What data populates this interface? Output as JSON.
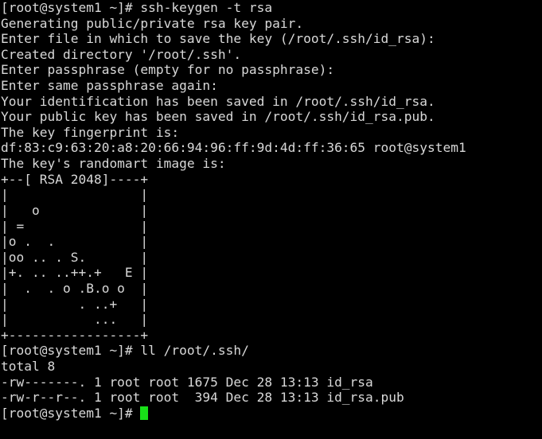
{
  "terminal": {
    "background_color": "#000000",
    "text_color": "#d8d8d8",
    "cursor_color": "#18e018",
    "prompt": "[root@system1 ~]#",
    "lines": [
      "[root@system1 ~]# ssh-keygen -t rsa",
      "Generating public/private rsa key pair.",
      "Enter file in which to save the key (/root/.ssh/id_rsa): ",
      "Created directory '/root/.ssh'.",
      "Enter passphrase (empty for no passphrase): ",
      "Enter same passphrase again: ",
      "Your identification has been saved in /root/.ssh/id_rsa.",
      "Your public key has been saved in /root/.ssh/id_rsa.pub.",
      "The key fingerprint is:",
      "df:83:c9:63:20:a8:20:66:94:96:ff:9d:4d:ff:36:65 root@system1",
      "The key's randomart image is:",
      "+--[ RSA 2048]----+",
      "|                 |",
      "|   o             |",
      "| =               |",
      "|o .  .           |",
      "|oo .. . S.       |",
      "|+. .. ..++.+   E |",
      "|  .  . o .B.o o  |",
      "|         . ..+   |",
      "|           ...   |",
      "+-----------------+",
      "[root@system1 ~]# ll /root/.ssh/",
      "total 8",
      "-rw-------. 1 root root 1675 Dec 28 13:13 id_rsa",
      "-rw-r--r--. 1 root root  394 Dec 28 13:13 id_rsa.pub"
    ],
    "last_prompt": "[root@system1 ~]# ",
    "commands": [
      "ssh-keygen -t rsa",
      "ll /root/.ssh/"
    ],
    "randomart": {
      "header": "+--[ RSA 2048]----+",
      "footer": "+-----------------+",
      "rows": [
        "|                 |",
        "|   o             |",
        "| =               |",
        "|o .  .           |",
        "|oo .. . S.       |",
        "|+. .. ..++.+   E |",
        "|  .  . o .B.o o  |",
        "|         . ..+   |",
        "|           ...   |"
      ]
    },
    "file_listing": {
      "total": "total 8",
      "entries": [
        {
          "permissions": "-rw-------.",
          "links": "1",
          "owner": "root",
          "group": "root",
          "size": "1675",
          "month": "Dec",
          "day": "28",
          "time": "13:13",
          "name": "id_rsa"
        },
        {
          "permissions": "-rw-r--r--.",
          "links": "1",
          "owner": "root",
          "group": "root",
          "size": "394",
          "month": "Dec",
          "day": "28",
          "time": "13:13",
          "name": "id_rsa.pub"
        }
      ]
    },
    "fingerprint": "df:83:c9:63:20:a8:20:66:94:96:ff:9d:4d:ff:36:65",
    "fingerprint_user": "root@system1",
    "key_type": "RSA 2048",
    "key_path": "/root/.ssh/id_rsa",
    "pub_key_path": "/root/.ssh/id_rsa.pub"
  }
}
